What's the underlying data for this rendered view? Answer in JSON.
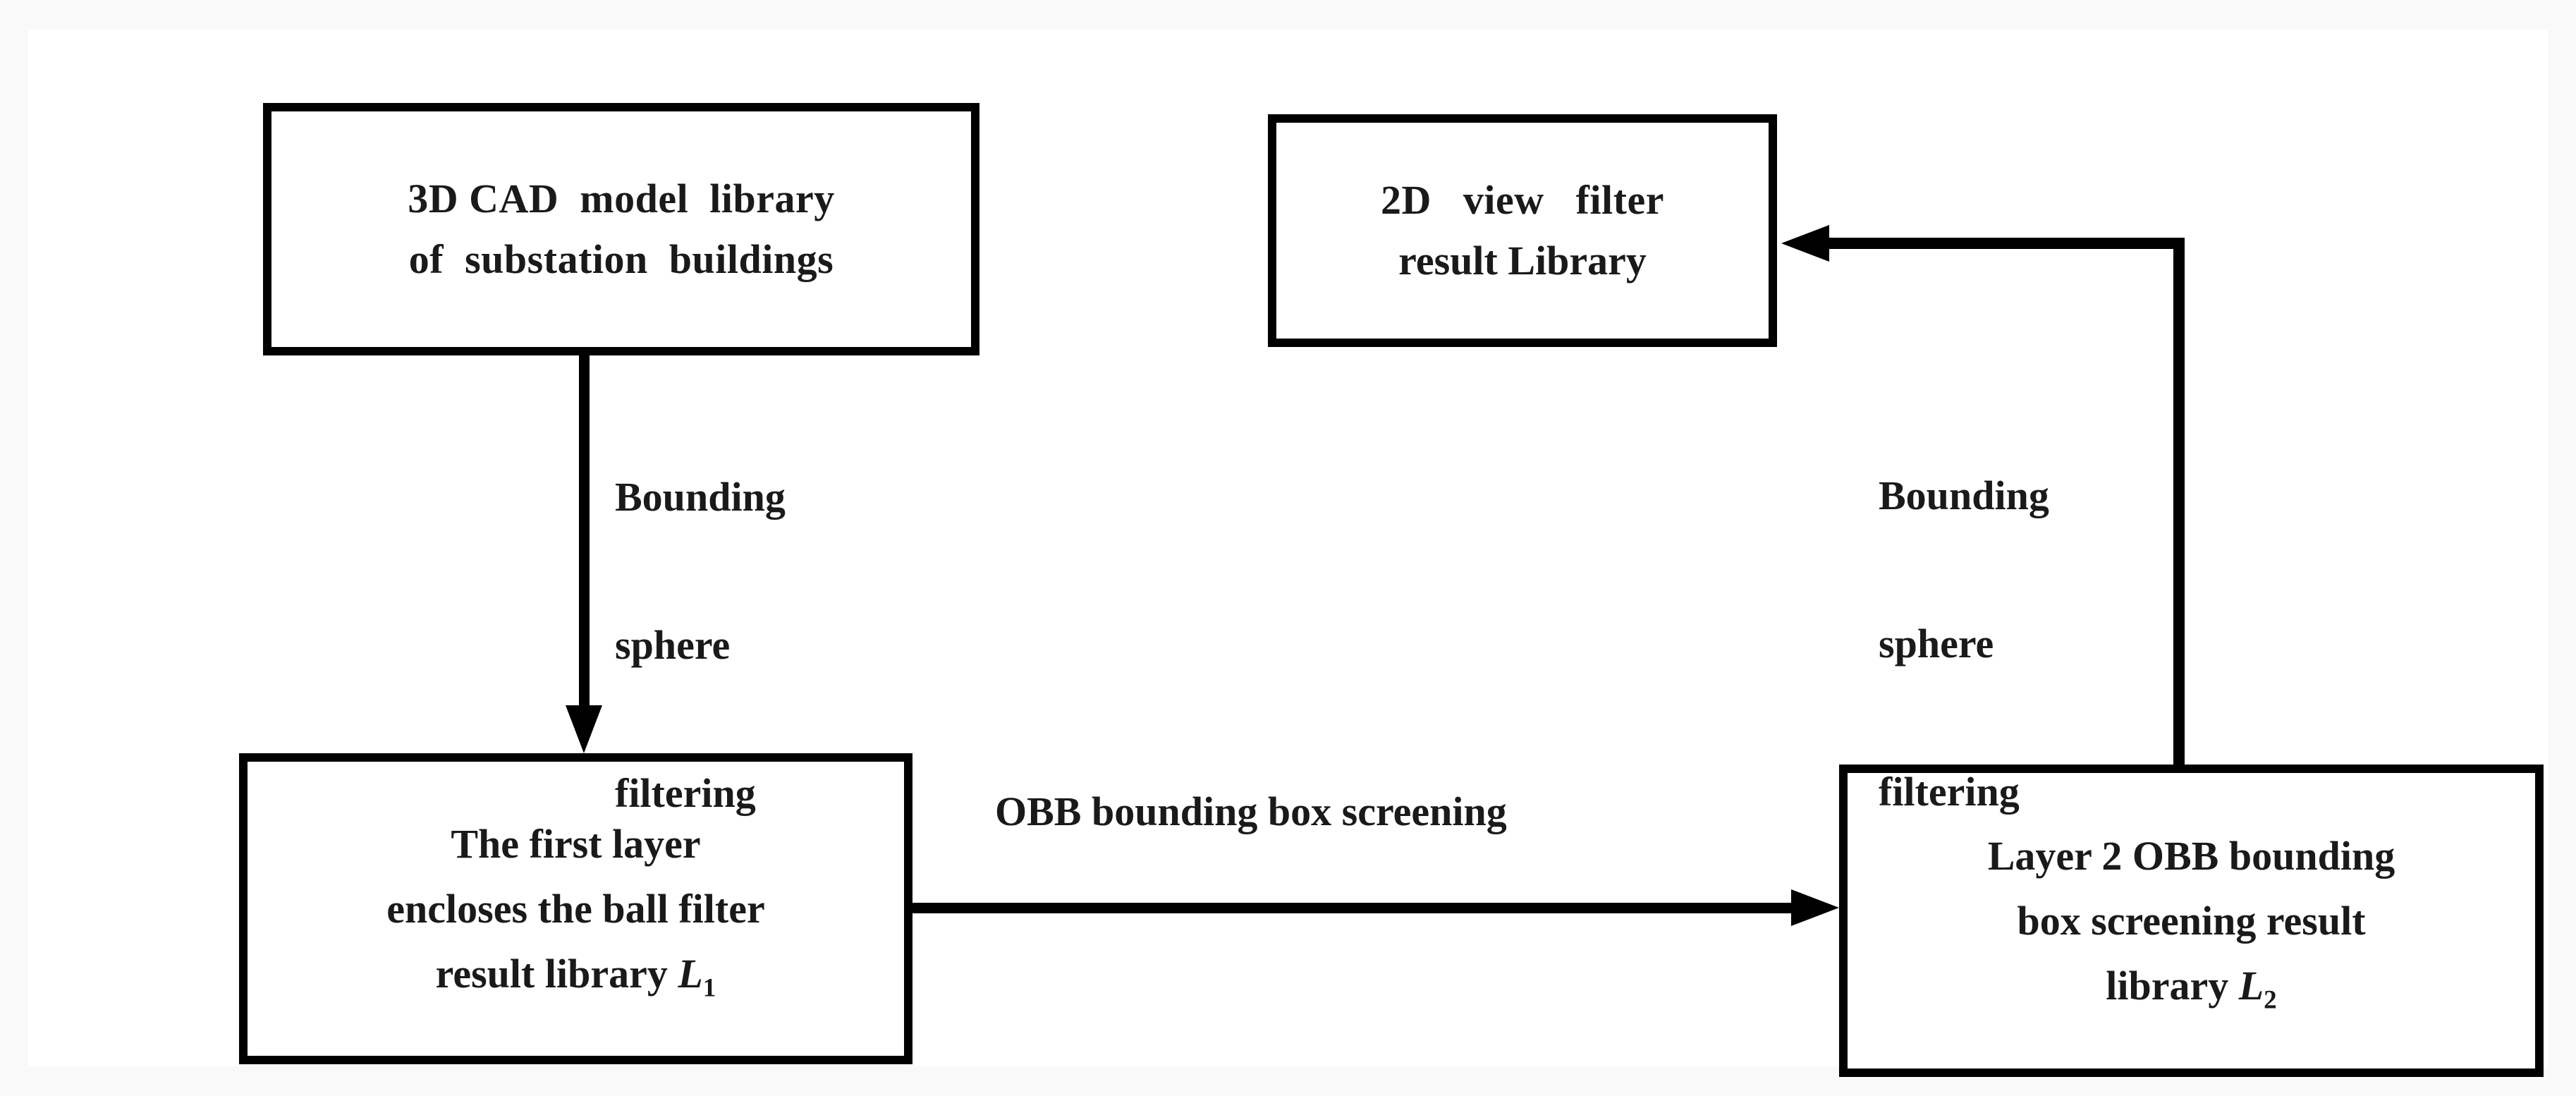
{
  "diagram": {
    "title": "Two-layer bounding volume filtering pipeline",
    "background_color": "#f9f9f9",
    "canvas_color": "#ffffff",
    "stroke_color": "#000000",
    "text_color": "#1a1a1a",
    "nodes": {
      "cad_library": {
        "id": "node-cad",
        "line1": "3D CAD  model  library",
        "line2": "of  substation  buildings"
      },
      "view_filter_library": {
        "id": "node-view",
        "line1": "2D   view   filter",
        "line2": "result Library"
      },
      "layer1_result": {
        "id": "node-l1",
        "line1": "The first layer",
        "line2": "encloses the ball filter",
        "line3_prefix": "result library ",
        "line3_symbol": "L",
        "line3_subscript": "1"
      },
      "layer2_result": {
        "id": "node-l2",
        "line1": "Layer 2 OBB bounding",
        "line2": "box screening result",
        "line3_prefix": "library ",
        "line3_symbol": "L",
        "line3_subscript": "2"
      }
    },
    "edges": {
      "cad_to_layer1": {
        "label_line1": "Bounding",
        "label_line2": "sphere",
        "label_line3": "filtering",
        "direction": "down",
        "arrowhead": "filled-triangle"
      },
      "layer1_to_layer2": {
        "label": "OBB bounding box screening",
        "direction": "right",
        "arrowhead": "filled-triangle"
      },
      "layer2_to_view": {
        "label_line1": "Bounding",
        "label_line2": "sphere",
        "label_line3": "filtering",
        "direction": "up-then-left",
        "arrowhead": "filled-triangle"
      }
    }
  }
}
